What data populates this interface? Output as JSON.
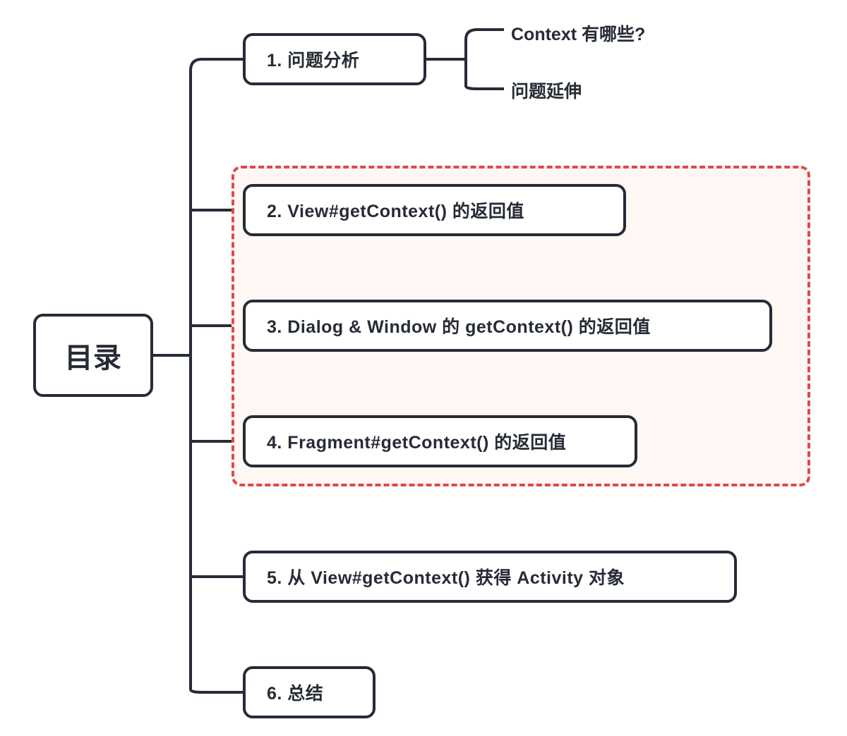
{
  "root": {
    "label": "目录"
  },
  "children": [
    {
      "label": "1. 问题分析"
    },
    {
      "label": "2. View#getContext() 的返回值"
    },
    {
      "label": "3. Dialog & Window 的 getContext() 的返回值"
    },
    {
      "label": "4. Fragment#getContext() 的返回值"
    },
    {
      "label": "5. 从 View#getContext() 获得 Activity 对象"
    },
    {
      "label": "6. 总结"
    }
  ],
  "child0_sub": [
    {
      "label": "Context 有哪些?"
    },
    {
      "label": "问题延伸"
    }
  ],
  "highlight": {
    "includes_children": [
      1,
      2,
      3
    ]
  },
  "colors": {
    "stroke": "#262b36",
    "highlight_border": "#de4a4a",
    "highlight_fill": "#fef7f4"
  }
}
